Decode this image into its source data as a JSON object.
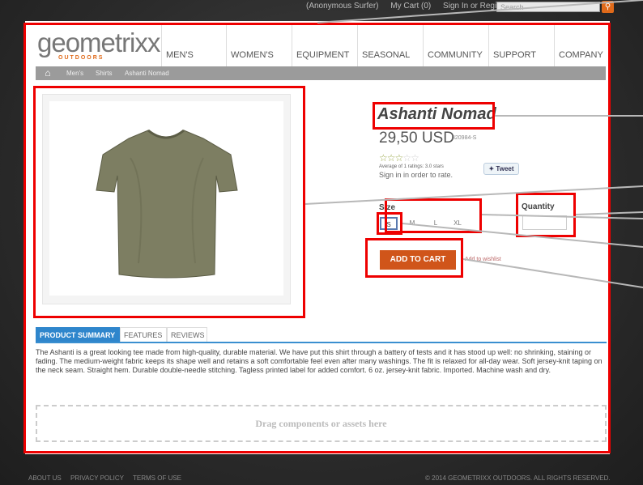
{
  "topbar": {
    "links": [
      "(Anonymous Surfer)",
      "My Cart (0)",
      "Sign In or Register"
    ],
    "search_placeholder": "Search"
  },
  "logo": {
    "name": "geometrixx",
    "sub": "OUTDOORS"
  },
  "nav": [
    "MEN'S",
    "WOMEN'S",
    "EQUIPMENT",
    "SEASONAL",
    "COMMUNITY",
    "SUPPORT",
    "COMPANY"
  ],
  "breadcrumb": [
    "Men's",
    "Shirts",
    "Ashanti Nomad"
  ],
  "product": {
    "title": "Ashanti Nomad",
    "price": "29,50 USD",
    "sku": "320984-S",
    "rating_text": "Average of 1 ratings: 3.0 stars",
    "rating_value": 3,
    "signin_text": "Sign in in order to rate.",
    "tweet_label": "Tweet",
    "size_label": "Size",
    "sizes": [
      "S",
      "M",
      "L",
      "XL"
    ],
    "selected_size": "S",
    "quantity_label": "Quantity",
    "add_to_cart": "ADD TO CART",
    "wishlist": "Add to wishlist"
  },
  "tabs": [
    "PRODUCT SUMMARY",
    "FEATURES",
    "REVIEWS"
  ],
  "description": "The Ashanti is a great looking tee made from high-quality, durable material. We have put this shirt through a battery of tests and it has stood up well: no shrinking, staining or fading. The medium-weight fabric keeps its shape well and retains a soft comfortable feel even after many washings. The fit is relaxed for all-day wear. Soft jersey-knit taping on the neck seam. Straight hem. Durable double-needle stitching. Tagless printed label for added comfort. 6 oz. jersey-knit fabric. Imported. Machine wash and dry.",
  "dropzone": "Drag components or assets here",
  "footer": {
    "links": [
      "ABOUT US",
      "PRIVACY POLICY",
      "TERMS OF USE"
    ],
    "copyright": "© 2014 GEOMETRIXX OUTDOORS. ALL RIGHTS RESERVED."
  },
  "colors": {
    "highlight": "#e00000",
    "accent": "#d0551a",
    "tab_active": "#2f86cc"
  }
}
